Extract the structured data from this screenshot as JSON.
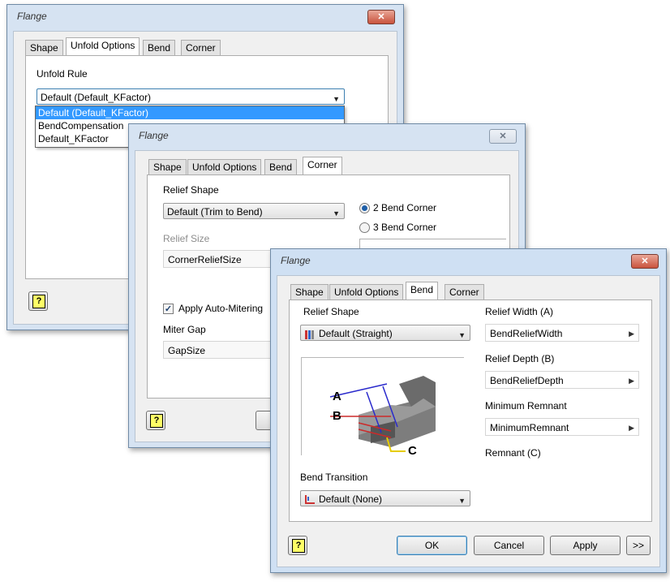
{
  "dialog1": {
    "title": "Flange",
    "close": "✕",
    "tabs": [
      "Shape",
      "Unfold Options",
      "Bend",
      "Corner"
    ],
    "unfold_rule_label": "Unfold Rule",
    "unfold_rule_value": "Default (Default_KFactor)",
    "dropdown_options": [
      "Default (Default_KFactor)",
      "BendCompensation",
      "Default_KFactor"
    ],
    "help": "?"
  },
  "dialog2": {
    "title": "Flange",
    "close": "✕",
    "tabs": [
      "Shape",
      "Unfold Options",
      "Bend",
      "Corner"
    ],
    "relief_shape_label": "Relief Shape",
    "relief_shape_value": "Default (Trim to Bend)",
    "radio_2": "2 Bend Corner",
    "radio_3": "3 Bend Corner",
    "relief_size_label": "Relief Size",
    "relief_size_value": "CornerReliefSize",
    "auto_mitering_label": "Apply Auto-Mitering",
    "miter_gap_label": "Miter Gap",
    "miter_gap_value": "GapSize",
    "help": "?"
  },
  "dialog3": {
    "title": "Flange",
    "close": "✕",
    "tabs": [
      "Shape",
      "Unfold Options",
      "Bend",
      "Corner"
    ],
    "relief_shape_label": "Relief Shape",
    "relief_shape_value": "Default (Straight)",
    "relief_width_label": "Relief Width (A)",
    "relief_width_value": "BendReliefWidth",
    "relief_depth_label": "Relief Depth (B)",
    "relief_depth_value": "BendReliefDepth",
    "min_remnant_label": "Minimum Remnant",
    "min_remnant_value": "MinimumRemnant",
    "remnant_label": "Remnant (C)",
    "diagram_labels": [
      "A",
      "B",
      "C"
    ],
    "bend_transition_label": "Bend Transition",
    "bend_transition_value": "Default (None)",
    "ok": "OK",
    "cancel": "Cancel",
    "apply": "Apply",
    "more": ">>",
    "help": "?"
  }
}
